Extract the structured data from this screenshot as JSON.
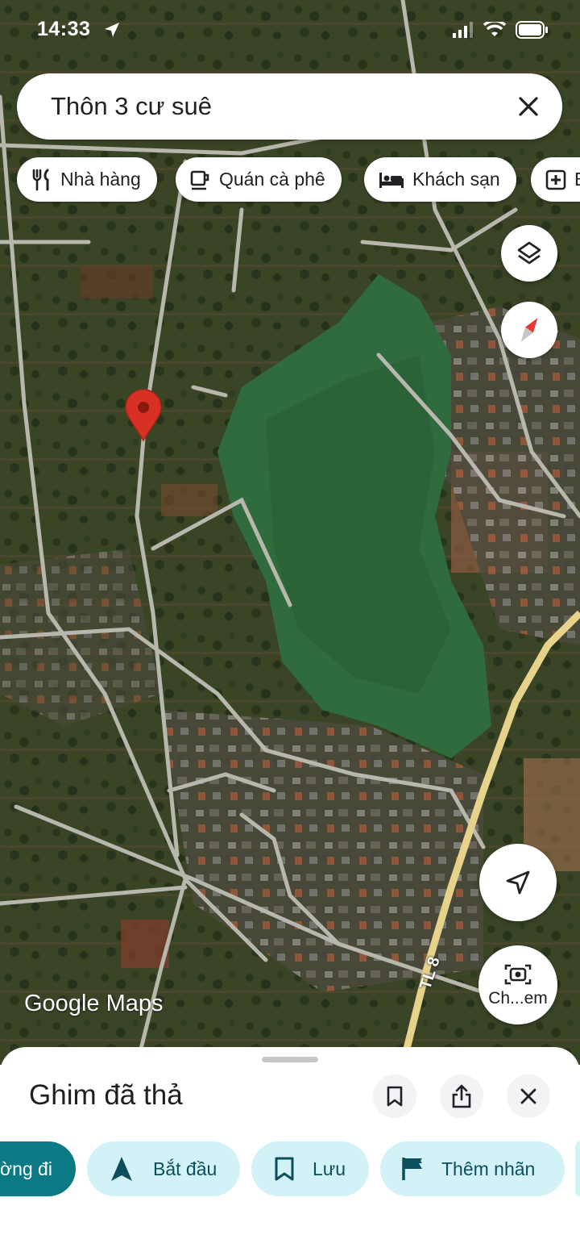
{
  "status_bar": {
    "time": "14:33"
  },
  "search": {
    "query": "Thôn 3 cư suê"
  },
  "chips": [
    {
      "label": "Nhà hàng",
      "icon": "fork-knife-icon"
    },
    {
      "label": "Quán cà phê",
      "icon": "coffee-cup-icon"
    },
    {
      "label": "Khách sạn",
      "icon": "bed-icon"
    },
    {
      "label": "B",
      "icon": "hospital-plus-icon"
    }
  ],
  "map": {
    "road_label": "TL 8",
    "camera_button_label": "Ch...em",
    "logo_google": "Google",
    "logo_maps": "Maps",
    "pin_color": "#d93025"
  },
  "sheet": {
    "title": "Ghim đã thả",
    "actions": [
      {
        "label": "ờng đi",
        "icon": "directions-icon"
      },
      {
        "label": "Bắt đầu",
        "icon": "navigation-arrow-icon"
      },
      {
        "label": "Lưu",
        "icon": "bookmark-icon"
      },
      {
        "label": "Thêm nhãn",
        "icon": "flag-icon"
      }
    ]
  }
}
